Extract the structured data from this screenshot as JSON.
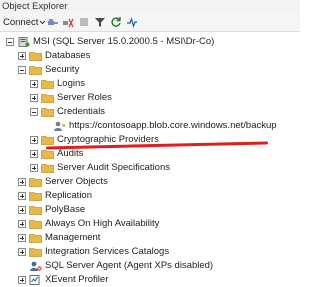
{
  "panel": {
    "title": "Object Explorer"
  },
  "toolbar": {
    "connect_label": "Connect"
  },
  "tree": {
    "server": "MSI (SQL Server 15.0.2000.5 - MSI\\Dr-Co)",
    "databases": "Databases",
    "security": "Security",
    "logins": "Logins",
    "server_roles": "Server Roles",
    "credentials": "Credentials",
    "credential_item": "https://contosoapp.blob.core.windows.net/backup",
    "cryptographic_providers": "Cryptographic Providers",
    "audits": "Audits",
    "server_audit_specifications": "Server Audit Specifications",
    "server_objects": "Server Objects",
    "replication": "Replication",
    "polybase": "PolyBase",
    "always_on": "Always On High Availability",
    "management": "Management",
    "integration_services": "Integration Services Catalogs",
    "sql_agent": "SQL Server Agent (Agent XPs disabled)",
    "xevent_profiler": "XEvent Profiler"
  },
  "colors": {
    "folder": "#e8b84a",
    "annotation": "#e01e1e"
  }
}
